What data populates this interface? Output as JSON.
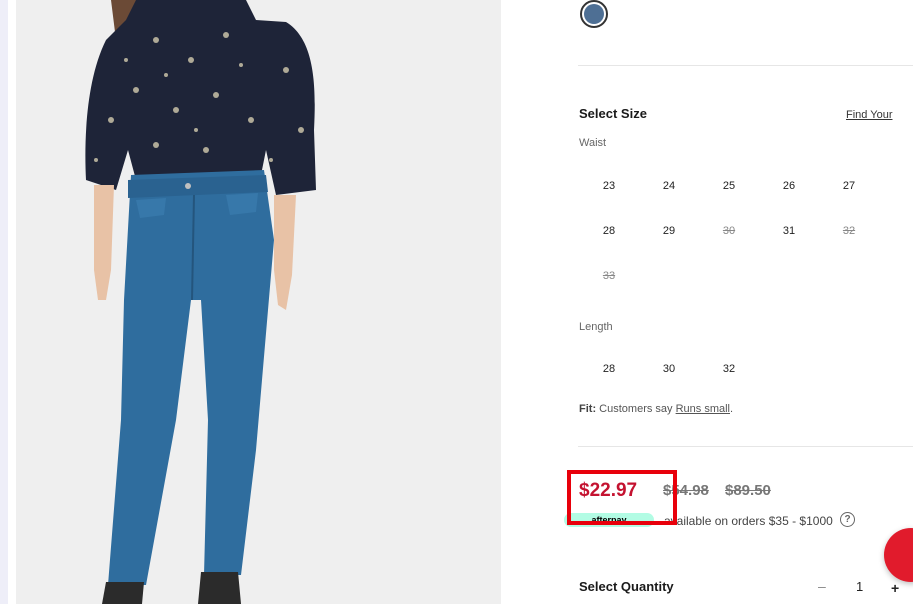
{
  "product_image": {
    "alt": "Model wearing floral blouse and blue skinny jeans",
    "icon": "product-photo"
  },
  "color_swatch": {
    "color": "#4e6f94",
    "selected": true
  },
  "size": {
    "title": "Select Size",
    "find_link": "Find Your",
    "waist_label": "Waist",
    "waist": [
      {
        "label": "23",
        "available": true
      },
      {
        "label": "24",
        "available": true
      },
      {
        "label": "25",
        "available": true
      },
      {
        "label": "26",
        "available": true
      },
      {
        "label": "27",
        "available": true
      },
      {
        "label": "28",
        "available": true
      },
      {
        "label": "29",
        "available": true
      },
      {
        "label": "30",
        "available": false
      },
      {
        "label": "31",
        "available": true
      },
      {
        "label": "32",
        "available": false
      },
      {
        "label": "33",
        "available": false
      }
    ],
    "length_label": "Length",
    "length": [
      {
        "label": "28",
        "available": true
      },
      {
        "label": "30",
        "available": true
      },
      {
        "label": "32",
        "available": true
      }
    ]
  },
  "fit": {
    "label": "Fit:",
    "text": "Customers say",
    "value": "Runs small",
    "suffix": "."
  },
  "price": {
    "sale": "$22.97",
    "original_1": "$54.98",
    "original_2": "$89.50",
    "sale_color": "#c41230",
    "highlight_color": "#e8000b"
  },
  "afterpay": {
    "badge": "afterpay",
    "text": "available on orders $35 - $1000",
    "info_icon": "info-icon",
    "badge_color": "#b2fce4"
  },
  "quantity": {
    "label": "Select Quantity",
    "minus": "–",
    "value": "1",
    "plus": "+"
  },
  "floating_button": {
    "color": "#e11b2c"
  }
}
